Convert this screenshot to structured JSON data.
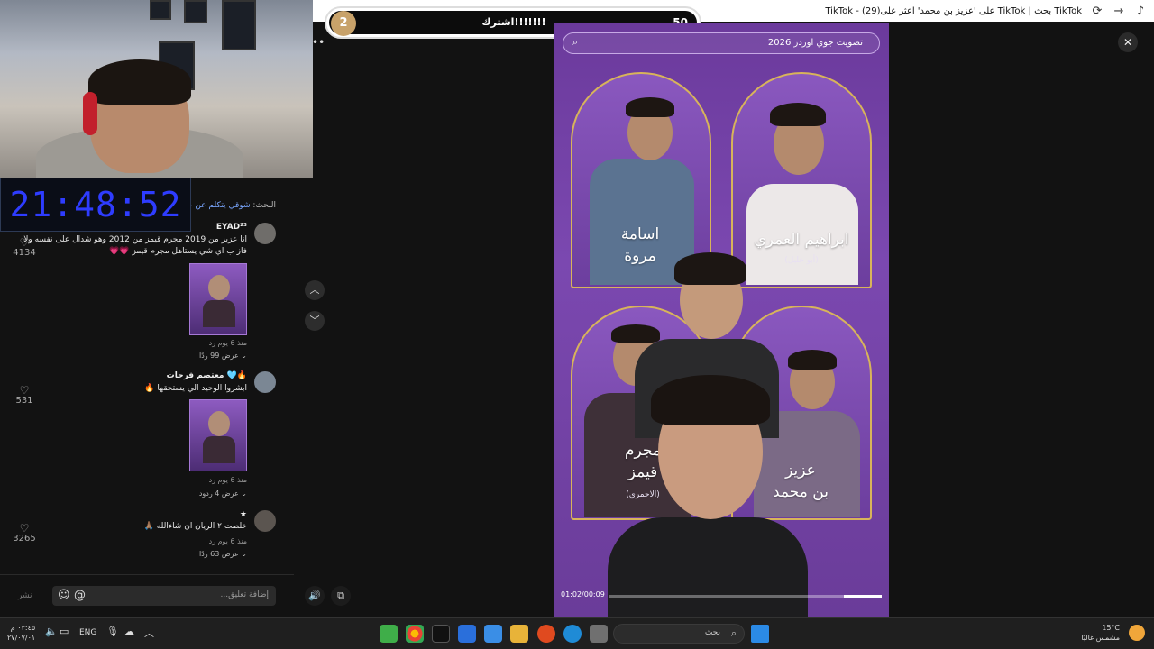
{
  "browser": {
    "title": "TikTok - (29)على 'عزيز بن محمد' اعثر على TikTok | بحث TikTok",
    "icons": [
      "tiktok-logo-icon",
      "forward-icon",
      "refresh-icon"
    ]
  },
  "clock": {
    "time": "21:48:52"
  },
  "goal": {
    "current": "2",
    "label": "اشترك!!!!!!!",
    "target": "50"
  },
  "comments_panel": {
    "search_prefix": "البحث:",
    "search_query": "شوقي يتكلم عن عزيز",
    "comments": [
      {
        "user": "EYAD²³",
        "text": "انا عزيز من 2019 مجرم قيمز من 2012 وهو شدال على نفسه ولا فاز ب اي شي يستاهل مجرم قيمز 💗💗",
        "likes": "4134",
        "meta": "منذ 6 يوم   رد",
        "replies": "عرض 99 ردًا",
        "has_thumb": true
      },
      {
        "user": "معتصم فرحات 🩵🔥",
        "text": "ابشروا الوحيد الي يستحقها 🔥",
        "likes": "531",
        "meta": "منذ 6 يوم   رد",
        "replies": "عرض 4 ردود",
        "has_thumb": true
      },
      {
        "user": "★",
        "text": "خلصت ٢ الريان ان شاءالله 🙏🏽",
        "likes": "3265",
        "meta": "منذ 6 يوم   رد",
        "replies": "عرض 63 ردًا",
        "has_thumb": false
      }
    ],
    "input_placeholder": "إضافة تعليق...",
    "post_label": "نشر"
  },
  "video": {
    "search_text": "تصويت جوي اوردز 2026",
    "candidates": [
      {
        "name_line1": "ابراهيم العمري",
        "name_line2": "",
        "sub": "(أبو خليل)"
      },
      {
        "name_line1": "اسامة",
        "name_line2": "مروة",
        "sub": ""
      },
      {
        "name_line1": "عزيز",
        "name_line2": "بن محمد",
        "sub": ""
      },
      {
        "name_line1": "مجرم",
        "name_line2": "قيمز",
        "sub": "(الاحمري)"
      }
    ],
    "time": "01:02/00:09",
    "progress": 0.14
  },
  "taskbar": {
    "weather_temp": "15°C",
    "weather_desc": "مشمس غالبًا",
    "search_placeholder": "بحث",
    "lang": "ENG",
    "time": "٠٣:٤٥ م",
    "date": "٢٧/٠٧/٠١"
  }
}
